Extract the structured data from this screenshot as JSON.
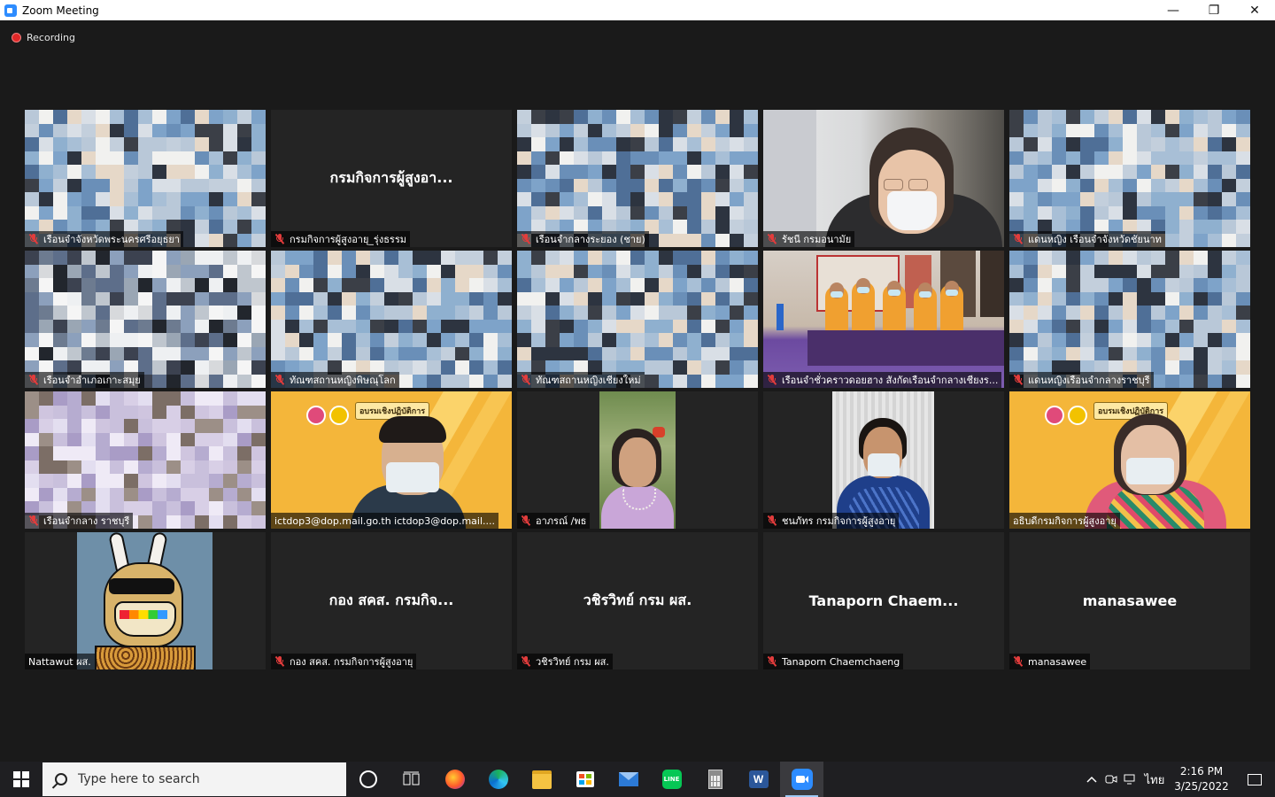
{
  "window": {
    "title": "Zoom Meeting",
    "minimize_glyph": "—",
    "restore_glyph": "❐",
    "close_glyph": "✕"
  },
  "recording": {
    "label": "Recording"
  },
  "tiles": [
    {
      "name": "เรือนจำจังหวัดพระนครศรีอยุธยา",
      "muted": true
    },
    {
      "name": "กรมกิจการผู้สูงอายุ_รุ่งธรรม",
      "display_name": "กรมกิจการผู้สูงอา...",
      "muted": true
    },
    {
      "name": "เรือนจำกลางระยอง (ชาย)",
      "muted": true
    },
    {
      "name": "รัชนี กรมอนามัย",
      "muted": true
    },
    {
      "name": "แดนหญิง เรือนจำจังหวัดชัยนาท",
      "muted": true
    },
    {
      "name": "เรือนจำอำเภอเกาะสมุย",
      "muted": true
    },
    {
      "name": "ทัณฑสถานหญิงพิษณุโลก",
      "muted": true
    },
    {
      "name": "ทัณฑสถานหญิงเชียงใหม่",
      "muted": true
    },
    {
      "name": "เรือนจำชั่วคราวดอยฮาง สังกัดเรือนจำกลางเชียงร...",
      "muted": true
    },
    {
      "name": "แดนหญิงเรือนจำกลางราชบุรี",
      "muted": true
    },
    {
      "name": "เรือนจำกลาง ราชบุรี",
      "muted": true
    },
    {
      "name": "ictdop3@dop.mail.go.th ictdop3@dop.mail....",
      "muted": false,
      "active": true,
      "slide_title": "อบรมเชิงปฏิบัติการ"
    },
    {
      "name": "อาภรณ์ /พธ",
      "muted": true
    },
    {
      "name": "ชนภัทร กรมกิจการผู้สูงอายุ",
      "muted": true
    },
    {
      "name": "อธิบดีกรมกิจการผู้สูงอายุ",
      "muted": false,
      "slide_title": "อบรมเชิงปฏิบัติการ"
    },
    {
      "name": "Nattawut ผส.",
      "muted": false
    },
    {
      "name": "กอง สคส. กรมกิจการผู้สูงอายุ",
      "display_name": "กอง สคส. กรมกิจ...",
      "muted": true
    },
    {
      "name": "วชิรวิทย์ กรม ผส.",
      "display_name": "วชิรวิทย์  กรม  ผส.",
      "muted": true
    },
    {
      "name": "Tanaporn Chaemchaeng",
      "display_name": "Tanaporn  Chaem...",
      "muted": true
    },
    {
      "name": "manasawee",
      "display_name": "manasawee",
      "muted": true
    }
  ],
  "taskbar": {
    "search_placeholder": "Type here to search",
    "apps": [
      "cortana-icon",
      "task-view-icon",
      "firefox-icon",
      "edge-icon",
      "file-explorer-icon",
      "store-icon",
      "mail-icon",
      "line-icon",
      "calculator-icon",
      "word-icon",
      "zoom-icon"
    ],
    "tray": {
      "chevron": "^",
      "language": "ไทย",
      "time": "2:16 PM",
      "date": "3/25/2022"
    }
  }
}
